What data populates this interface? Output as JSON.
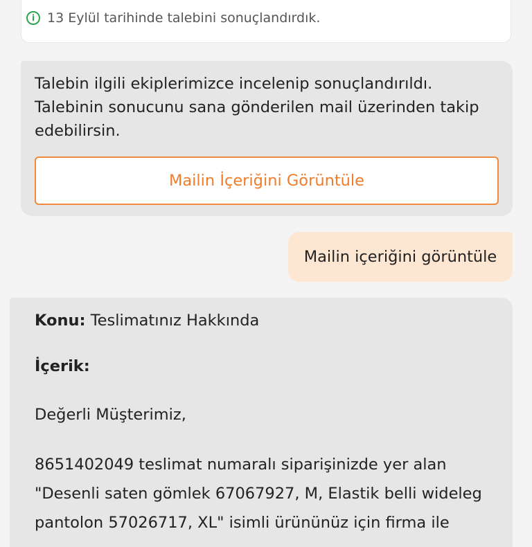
{
  "status": {
    "icon": "info-icon",
    "icon_glyph": "i",
    "text": "13 Eylül tarihinde talebini sonuçlandırdık."
  },
  "bot_message": {
    "text": "Talebin ilgili ekiplerimizce incelenip sonuçlandırıldı. Talebinin sonucunu sana gönderilen mail üzerinden takip edebilirsin.",
    "button_label": "Mailin İçeriğini Görüntüle"
  },
  "user_message": {
    "text": "Mailin içeriğini görüntüle"
  },
  "mail": {
    "subject_label": "Konu:",
    "subject_value": "Teslimatınız Hakkında",
    "content_label": "İçerik:",
    "greeting": "Değerli Müşterimiz,",
    "body": "8651402049 teslimat numaralı siparişinizde yer alan \"Desenli saten gömlek 67067927, M, Elastik belli wideleg pantolon 57026717, XL\" isimli ürününüz için firma ile"
  },
  "colors": {
    "accent_orange": "#ef7d2c",
    "success_green": "#2ea44f",
    "user_bubble": "#fde6d2",
    "bot_bubble": "#e6e6e6"
  }
}
